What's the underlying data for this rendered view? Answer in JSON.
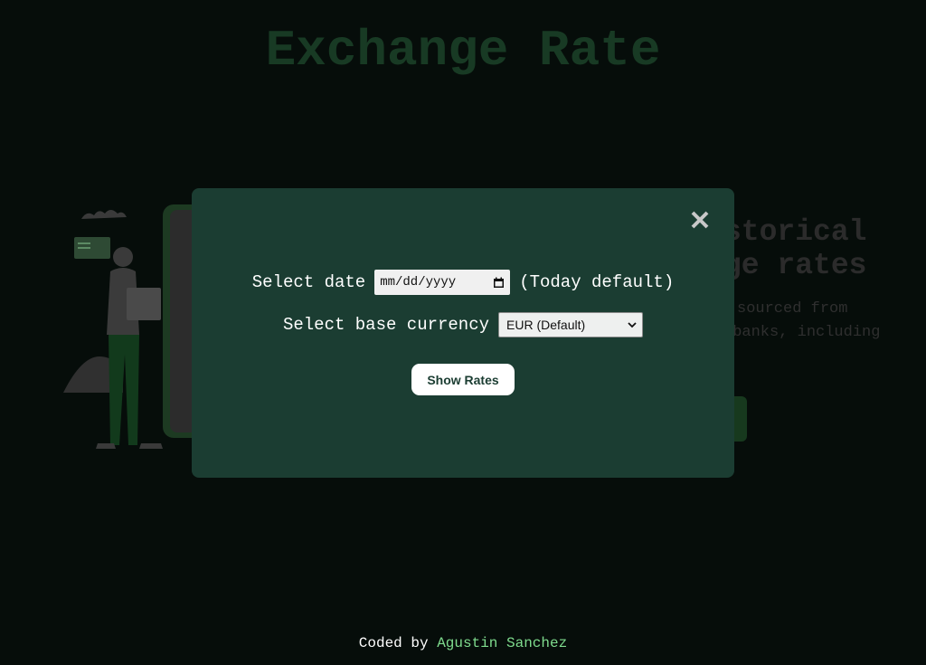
{
  "page": {
    "title": "Exchange Rate"
  },
  "hero": {
    "heading_line1": "storical",
    "heading_line2": "ge rates",
    "desc_line1": "sourced from",
    "desc_line2": " banks, including"
  },
  "modal": {
    "date_label": "Select date",
    "date_placeholder": "mm/dd/yyyy",
    "date_hint": "(Today default)",
    "currency_label": "Select base currency",
    "currency_selected": "EUR (Default)",
    "show_button": "Show Rates"
  },
  "footer": {
    "prefix": "Coded by ",
    "author": "Agustin Sanchez"
  },
  "icons": {
    "close": "close-icon",
    "calendar": "calendar-icon",
    "dropdown": "chevron-down-icon"
  },
  "colors": {
    "background": "#060d0a",
    "modal": "#1b3d32",
    "title": "#183a24",
    "link": "#7fdc8e"
  }
}
